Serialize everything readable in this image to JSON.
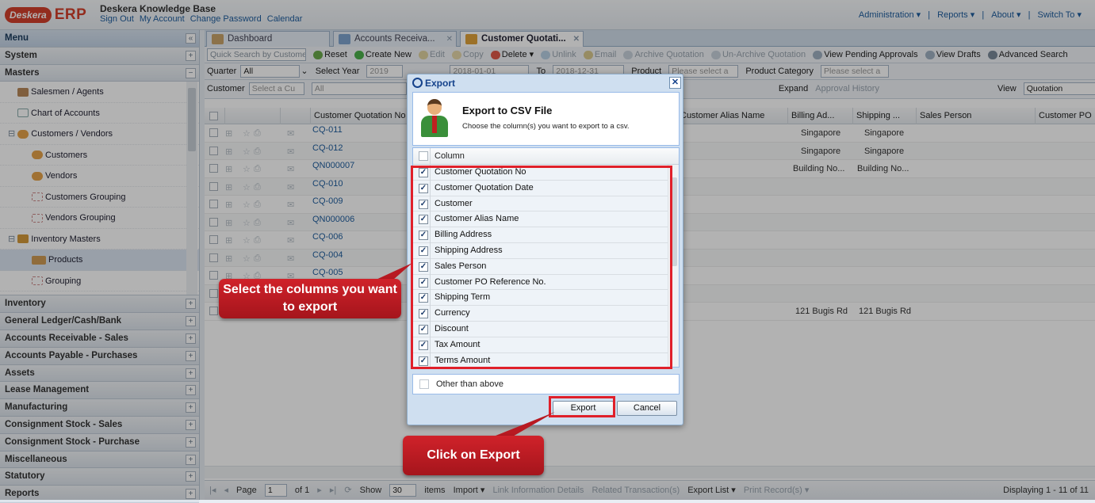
{
  "header": {
    "logo_badge": "Deskera",
    "logo_erp": "ERP",
    "kb_title": "Deskera Knowledge Base",
    "links": [
      "Sign Out",
      "My Account",
      "Change Password",
      "Calendar"
    ],
    "right_links": [
      "Administration ▾",
      "|",
      "Reports ▾",
      "|",
      "About ▾",
      "|",
      "Switch To ▾"
    ]
  },
  "sidebar": {
    "menu_label": "Menu",
    "sections_top": [
      "System",
      "Masters"
    ],
    "tree": [
      {
        "label": "Salesmen / Agents",
        "icon": "salesmen-icon",
        "indent": 1
      },
      {
        "label": "Chart of Accounts",
        "icon": "chart-icon",
        "indent": 1
      },
      {
        "label": "Customers / Vendors",
        "icon": "customers-vendors-icon",
        "indent": 0
      },
      {
        "label": "Customers",
        "icon": "customer-icon",
        "indent": 2
      },
      {
        "label": "Vendors",
        "icon": "vendor-icon",
        "indent": 2
      },
      {
        "label": "Customers Grouping",
        "icon": "grouping-icon",
        "indent": 2
      },
      {
        "label": "Vendors Grouping",
        "icon": "grouping-icon",
        "indent": 2
      },
      {
        "label": "Inventory Masters",
        "icon": "inventory-icon",
        "indent": 0
      },
      {
        "label": "Products",
        "icon": "products-icon",
        "indent": 2
      },
      {
        "label": "Grouping",
        "icon": "grouping-icon",
        "indent": 2
      }
    ],
    "sections_bottom": [
      "Inventory",
      "General Ledger/Cash/Bank",
      "Accounts Receivable - Sales",
      "Accounts Payable - Purchases",
      "Assets",
      "Lease Management",
      "Manufacturing",
      "Consignment Stock - Sales",
      "Consignment Stock - Purchase",
      "Miscellaneous",
      "Statutory",
      "Reports"
    ]
  },
  "tabs": [
    "Dashboard",
    "Accounts Receiva...",
    "Customer Quotati..."
  ],
  "toolbar1": [
    "Quick Search by Customer Q",
    "Reset",
    "Create New",
    "Edit",
    "Copy",
    "Delete ▾",
    "Unlink",
    "Email",
    "Archive Quotation",
    "Un-Archive Quotation",
    "View Pending Approvals",
    "View Drafts",
    "Advanced Search"
  ],
  "toolbar2": {
    "quarter_label": "Quarter",
    "quarter_value": "All",
    "year_label": "Select Year",
    "year_value": "2019",
    "from_value": "2018-01-01",
    "to_label": "To",
    "to_value": "2018-12-31",
    "product_label": "Product",
    "product_value": "Please select a",
    "category_label": "Product Category",
    "category_value": "Please select a"
  },
  "toolbar3": {
    "customer_label": "Customer",
    "customer_value": "Select a Cu",
    "filter_value": "All",
    "expand": "Expand",
    "approval": "Approval History",
    "view_label": "View",
    "view_value": "Quotation"
  },
  "grid": {
    "headers": [
      "Customer Quotation No",
      "Customer Alias Name",
      "Billing Ad...",
      "Shipping ...",
      "Sales Person",
      "Customer PO"
    ],
    "rows": [
      {
        "no": "CQ-011",
        "billing": "Singapore",
        "shipping": "Singapore"
      },
      {
        "no": "CQ-012",
        "billing": "Singapore",
        "shipping": "Singapore"
      },
      {
        "no": "QN000007",
        "billing": "Building No...",
        "shipping": "Building No..."
      },
      {
        "no": "CQ-010",
        "billing": "",
        "shipping": ""
      },
      {
        "no": "CQ-009",
        "billing": "",
        "shipping": ""
      },
      {
        "no": "QN000006",
        "billing": "",
        "shipping": ""
      },
      {
        "no": "CQ-006",
        "billing": "",
        "shipping": ""
      },
      {
        "no": "CQ-004",
        "billing": "",
        "shipping": ""
      },
      {
        "no": "CQ-005",
        "billing": "",
        "shipping": ""
      },
      {
        "no": "",
        "billing": "",
        "shipping": ""
      },
      {
        "no": "",
        "billing": "121 Bugis Rd",
        "shipping": "121 Bugis Rd"
      }
    ]
  },
  "pager": {
    "page_label": "Page",
    "page_value": "1",
    "of_label": "of 1",
    "show_label": "Show",
    "show_value": "30",
    "items_label": "items",
    "import": "Import ▾",
    "link_info": "Link Information Details",
    "related": "Related Transaction(s)",
    "export_list": "Export List ▾",
    "print": "Print Record(s) ▾",
    "displaying": "Displaying 1 - 11 of 11"
  },
  "dialog": {
    "title": "Export",
    "close": "✕",
    "heading": "Export to CSV File",
    "subheading": "Choose the column(s) you want to export to a csv.",
    "column_header": "Column",
    "columns": [
      "Customer Quotation No",
      "Customer Quotation Date",
      "Customer",
      "Customer Alias Name",
      "Billing Address",
      "Shipping Address",
      "Sales Person",
      "Customer PO Reference No.",
      "Shipping Term",
      "Currency",
      "Discount",
      "Tax Amount",
      "Terms Amount"
    ],
    "other_label": "Other than above",
    "export_button": "Export",
    "cancel_button": "Cancel"
  },
  "callouts": {
    "select_columns": "Select the columns you want to export",
    "click_export": "Click on Export"
  },
  "colors": {
    "brand": "#d3402b",
    "callout": "#c41e26",
    "highlight": "#e0202a",
    "link": "#1f5e9e"
  }
}
